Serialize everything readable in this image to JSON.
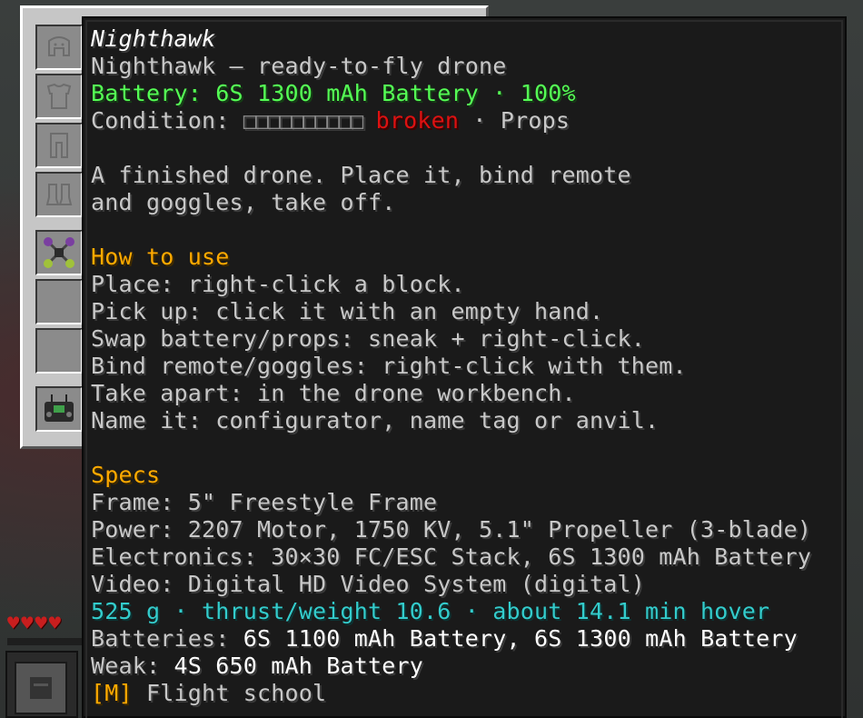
{
  "tooltip": {
    "title": "Nighthawk",
    "subtitle": "Nighthawk — ready-to-fly drone",
    "battery": "Battery: 6S 1300 mAh Battery · 100%",
    "condition": {
      "label": "Condition:",
      "bar": "□□□□□□□□□□",
      "status": "broken",
      "suffix": "· Props"
    },
    "description": [
      "A finished drone. Place it, bind remote",
      "and goggles, take off."
    ],
    "how_to_use": {
      "heading": "How to use",
      "lines": [
        "Place: right-click a block.",
        "Pick up: click it with an empty hand.",
        "Swap battery/props: sneak + right-click.",
        "Bind remote/goggles: right-click with them.",
        "Take apart: in the drone workbench.",
        "Name it: configurator, name tag or anvil."
      ]
    },
    "specs": {
      "heading": "Specs",
      "lines": [
        "Frame: 5\" Freestyle Frame",
        "Power: 2207 Motor, 1750 KV, 5.1\" Propeller (3-blade)",
        "Electronics: 30×30 FC/ESC Stack, 6S 1300 mAh Battery",
        "Video: Digital HD Video System (digital)"
      ],
      "performance": "525 g · thrust/weight 10.6 · about 14.1 min hover",
      "batteries_label": "Batteries:",
      "batteries_value": "6S 1100 mAh Battery, 6S 1300 mAh Battery",
      "weak_label": "Weak:",
      "weak_value": "4S 650 mAh Battery",
      "key_hint": "[M]",
      "key_action": "Flight school"
    }
  },
  "inventory": {
    "slots": [
      "helmet-slot-icon",
      "chestplate-slot-icon",
      "leggings-slot-icon",
      "boots-slot-icon",
      "drone-item-icon",
      "empty-slot",
      "empty-slot",
      "remote-controller-icon"
    ]
  },
  "hud": {
    "hearts": 4
  },
  "colors": {
    "tooltip_bg": "#1a1a1a",
    "text_gray": "#c8c8c8",
    "green": "#55ff55",
    "red": "#dd1111",
    "gold": "#ffaa00",
    "aqua": "#33cccc"
  }
}
